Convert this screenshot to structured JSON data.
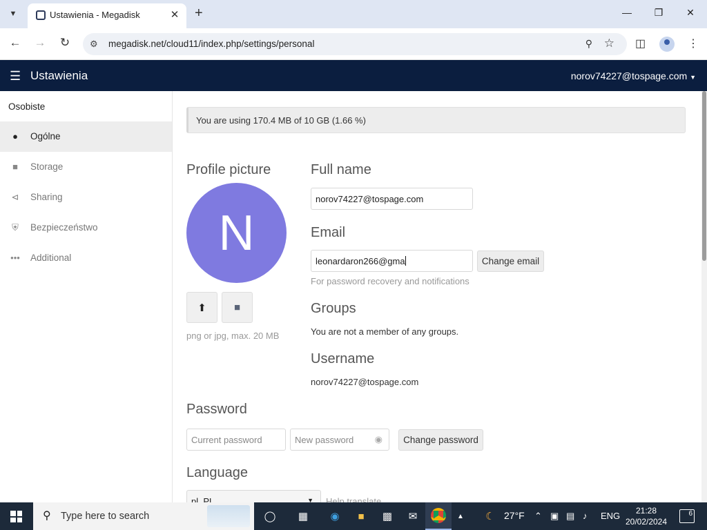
{
  "browser": {
    "tab_title": "Ustawienia - Megadisk",
    "url": "megadisk.net/cloud11/index.php/settings/personal"
  },
  "header": {
    "app_title": "Ustawienia",
    "user": "norov74227@tospage.com"
  },
  "sidebar": {
    "heading": "Osobiste",
    "items": [
      {
        "label": "Ogólne",
        "icon": "person-icon",
        "active": true
      },
      {
        "label": "Storage",
        "icon": "folder-icon",
        "active": false
      },
      {
        "label": "Sharing",
        "icon": "share-icon",
        "active": false
      },
      {
        "label": "Bezpieczeństwo",
        "icon": "shield-icon",
        "active": false
      },
      {
        "label": "Additional",
        "icon": "more-icon",
        "active": false
      }
    ]
  },
  "main": {
    "quota_text": "You are using 170.4 MB of 10 GB (1.66 %)",
    "profile": {
      "heading": "Profile picture",
      "avatar_letter": "N",
      "avatar_color": "#7f7ae0",
      "hint": "png or jpg, max. 20 MB"
    },
    "full_name": {
      "heading": "Full name",
      "value": "norov74227@tospage.com"
    },
    "email": {
      "heading": "Email",
      "value": "leonardaron266@gma",
      "button": "Change email",
      "hint": "For password recovery and notifications"
    },
    "groups": {
      "heading": "Groups",
      "text": "You are not a member of any groups."
    },
    "username": {
      "heading": "Username",
      "value": "norov74227@tospage.com"
    },
    "password": {
      "heading": "Password",
      "current_placeholder": "Current password",
      "new_placeholder": "New password",
      "button": "Change password"
    },
    "language": {
      "heading": "Language",
      "selected": "pl_PL",
      "help": "Help translate"
    }
  },
  "taskbar": {
    "search_placeholder": "Type here to search",
    "weather": "27°F",
    "lang": "ENG",
    "time": "21:28",
    "date": "20/02/2024",
    "notifications": "6"
  },
  "colors": {
    "header_bg": "#0b1e3f",
    "accent": "#7f7ae0"
  }
}
